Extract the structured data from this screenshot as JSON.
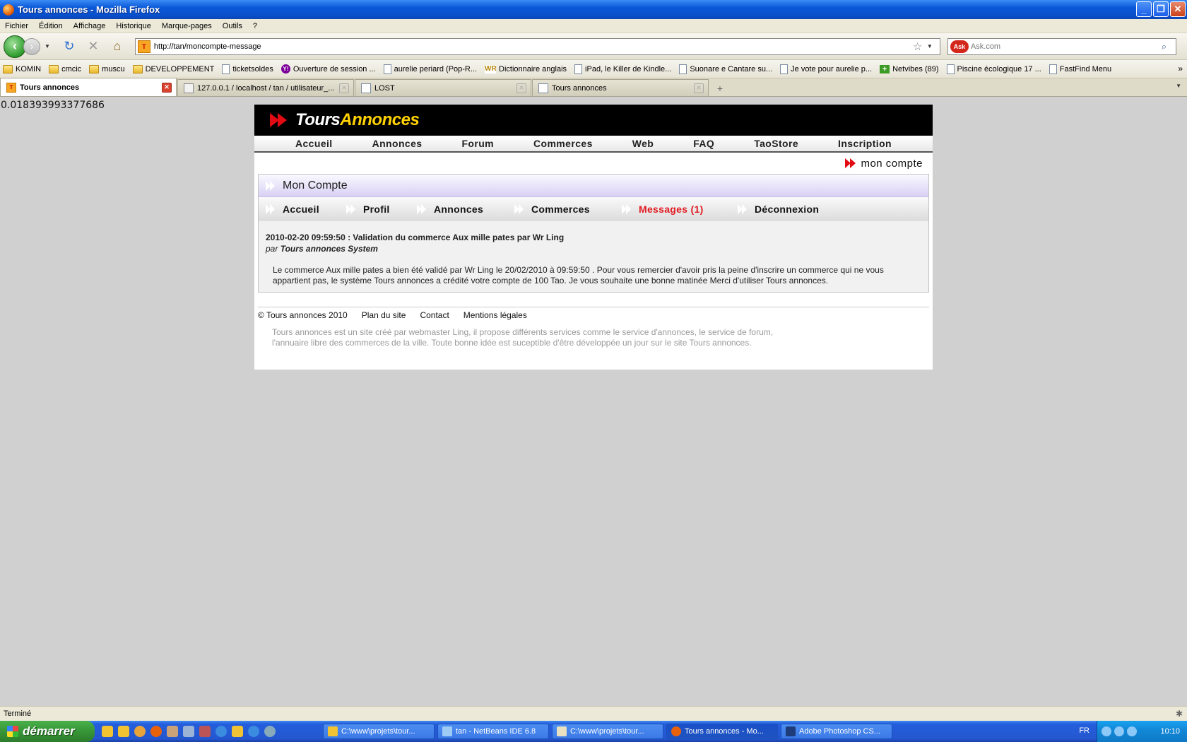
{
  "window": {
    "title": "Tours annonces - Mozilla Firefox"
  },
  "menu": [
    "Fichier",
    "Édition",
    "Affichage",
    "Historique",
    "Marque-pages",
    "Outils",
    "?"
  ],
  "navbar": {
    "url": "http://tan/moncompte-message",
    "search_placeholder": "Ask.com",
    "favicon_text": "T"
  },
  "bookmarks": [
    {
      "label": "KOMIN",
      "icon": "folder"
    },
    {
      "label": "cmcic",
      "icon": "folder"
    },
    {
      "label": "muscu",
      "icon": "folder"
    },
    {
      "label": "DEVELOPPEMENT",
      "icon": "folder"
    },
    {
      "label": "ticketsoldes",
      "icon": "page"
    },
    {
      "label": "Ouverture de session ...",
      "icon": "yahoo"
    },
    {
      "label": "aurelie periard (Pop-R...",
      "icon": "page"
    },
    {
      "label": "Dictionnaire anglais",
      "icon": "wr"
    },
    {
      "label": "iPad, le Killer de Kindle...",
      "icon": "page"
    },
    {
      "label": "Suonare e Cantare su...",
      "icon": "page"
    },
    {
      "label": "Je vote pour aurelie p...",
      "icon": "page"
    },
    {
      "label": "Netvibes (89)",
      "icon": "netvibes"
    },
    {
      "label": "Piscine écologique 17 ...",
      "icon": "page"
    },
    {
      "label": "FastFind Menu",
      "icon": "page"
    }
  ],
  "tabs": [
    {
      "label": "Tours annonces",
      "active": true
    },
    {
      "label": "127.0.0.1 / localhost / tan / utilisateur_...",
      "active": false
    },
    {
      "label": "LOST",
      "active": false
    },
    {
      "label": "Tours annonces",
      "active": false
    }
  ],
  "debug_value": "0.018393993377686",
  "site": {
    "logo_white": "Tours",
    "logo_yellow": "Annonces",
    "nav": [
      "Accueil",
      "Annonces",
      "Forum",
      "Commerces",
      "Web",
      "FAQ",
      "TaoStore",
      "Inscription"
    ],
    "account_link": "mon compte",
    "panel_title": "Mon Compte",
    "subnav": [
      {
        "label": "Accueil",
        "active": false
      },
      {
        "label": "Profil",
        "active": false
      },
      {
        "label": "Annonces",
        "active": false
      },
      {
        "label": "Commerces",
        "active": false
      },
      {
        "label": "Messages (1)",
        "active": true
      },
      {
        "label": "Déconnexion",
        "active": false
      }
    ],
    "message": {
      "header": "2010-02-20 09:59:50 : Validation du commerce Aux mille pates par Wr Ling",
      "by_prefix": "par",
      "by_author": "Tours annonces System",
      "body": "Le commerce Aux mille pates a bien été validé par Wr Ling le 20/02/2010 à 09:59:50 . Pour vous remercier d'avoir pris la peine d'inscrire un commerce qui ne vous appartient pas, le système Tours annonces a crédité votre compte de 100 Tao. Je vous souhaite une bonne matinée Merci d'utiliser Tours annonces."
    },
    "footer": {
      "links": [
        "© Tours annonces 2010",
        "Plan du site",
        "Contact",
        "Mentions légales"
      ],
      "text": "Tours annonces est un site créé par webmaster Ling, il propose différents services comme le service d'annonces, le service de forum, l'annuaire libre des commerces de la ville. Toute bonne idée est suceptible d'être développée un jour sur le site Tours annonces."
    }
  },
  "statusbar": {
    "text": "Terminé"
  },
  "taskbar": {
    "start_label": "démarrer",
    "items": [
      {
        "label": "C:\\www\\projets\\tour...",
        "active": false
      },
      {
        "label": "tan - NetBeans IDE 6.8",
        "active": false
      },
      {
        "label": "C:\\www\\projets\\tour...",
        "active": false
      },
      {
        "label": "Tours annonces - Mo...",
        "active": true
      },
      {
        "label": "Adobe Photoshop CS...",
        "active": false
      }
    ],
    "lang": "FR",
    "clock": "10:10"
  }
}
